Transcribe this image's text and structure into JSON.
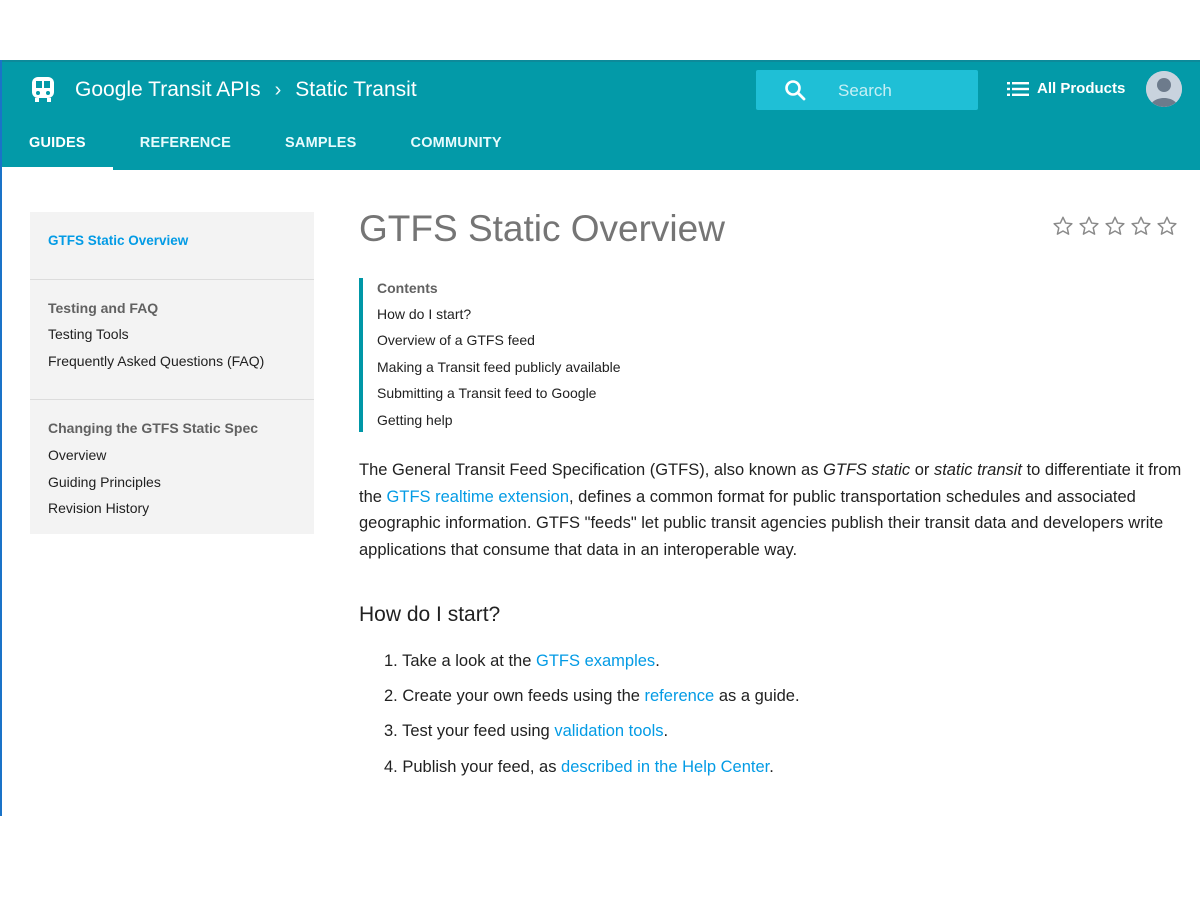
{
  "header": {
    "api_name": "Google Transit APIs",
    "separator": "›",
    "section": "Static Transit",
    "search_placeholder": "Search",
    "all_products": "All Products",
    "colors": {
      "bar": "#039aa8",
      "search": "#1fbfd6",
      "link": "#039be5",
      "toc_accent": "#0097a7"
    }
  },
  "tabs": [
    {
      "label": "GUIDES",
      "active": true
    },
    {
      "label": "REFERENCE",
      "active": false
    },
    {
      "label": "SAMPLES",
      "active": false
    },
    {
      "label": "COMMUNITY",
      "active": false
    }
  ],
  "sidebar": {
    "current": "GTFS Static Overview",
    "group1_heading": "Testing and FAQ",
    "group1_items": [
      "Testing Tools",
      "Frequently Asked Questions (FAQ)"
    ],
    "group2_heading": "Changing the GTFS Static Spec",
    "group2_items": [
      "Overview",
      "Guiding Principles",
      "Revision History"
    ]
  },
  "page": {
    "title": "GTFS Static Overview",
    "rating_stars": 5,
    "toc_heading": "Contents",
    "toc_items": [
      "How do I start?",
      "Overview of a GTFS feed",
      "Making a Transit feed publicly available",
      "Submitting a Transit feed to Google",
      "Getting help"
    ],
    "intro": {
      "t1": "The General Transit Feed Specification (GTFS), also known as ",
      "em1": "GTFS static",
      "t2": " or ",
      "em2": "static transit",
      "t3": " to differentiate it from the ",
      "link1": "GTFS realtime extension",
      "t4": ", defines a common format for public transportation schedules and associated geographic information. GTFS \"feeds\" let public transit agencies publish their transit data and developers write applications that consume that data in an interoperable way."
    },
    "section_heading": "How do I start?",
    "steps": [
      {
        "num": "1.",
        "before": "Take a look at the ",
        "link": "GTFS examples",
        "after": "."
      },
      {
        "num": "2.",
        "before": "Create your own feeds using the ",
        "link": "reference",
        "after": " as a guide."
      },
      {
        "num": "3.",
        "before": "Test your feed using ",
        "link": "validation tools",
        "after": "."
      },
      {
        "num": "4.",
        "before": "Publish your feed, as ",
        "link": "described in the Help Center",
        "after": "."
      }
    ]
  }
}
